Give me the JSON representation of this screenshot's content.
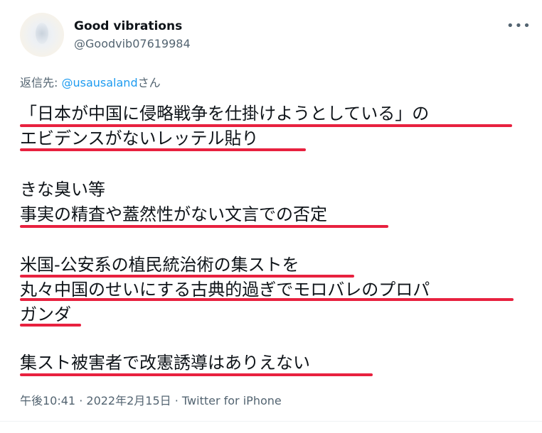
{
  "user": {
    "display_name": "Good vibrations",
    "handle": "@Goodvib07619984"
  },
  "more_icon": "more-horizontal-icon",
  "reply": {
    "prefix": "返信先: ",
    "mention": "@usausaland",
    "suffix": "さん"
  },
  "tweet_lines": [
    "「日本が中国に侵略戦争を仕掛けようとしている」の",
    "エビデンスがないレッテル貼り",
    "きな臭い等",
    "事実の精査や蓋然性がない文言での否定",
    "米国-公安系の植民統治術の集ストを",
    "丸々中国のせいにする古典的過ぎでモロバレのプロパ",
    "ガンダ",
    "集スト被害者で改憲誘導はありえない"
  ],
  "underline_color": "#e8213f",
  "meta": {
    "time": "午後10:41",
    "sep1": " · ",
    "date": "2022年2月15日",
    "sep2": " · ",
    "source": "Twitter for iPhone"
  }
}
